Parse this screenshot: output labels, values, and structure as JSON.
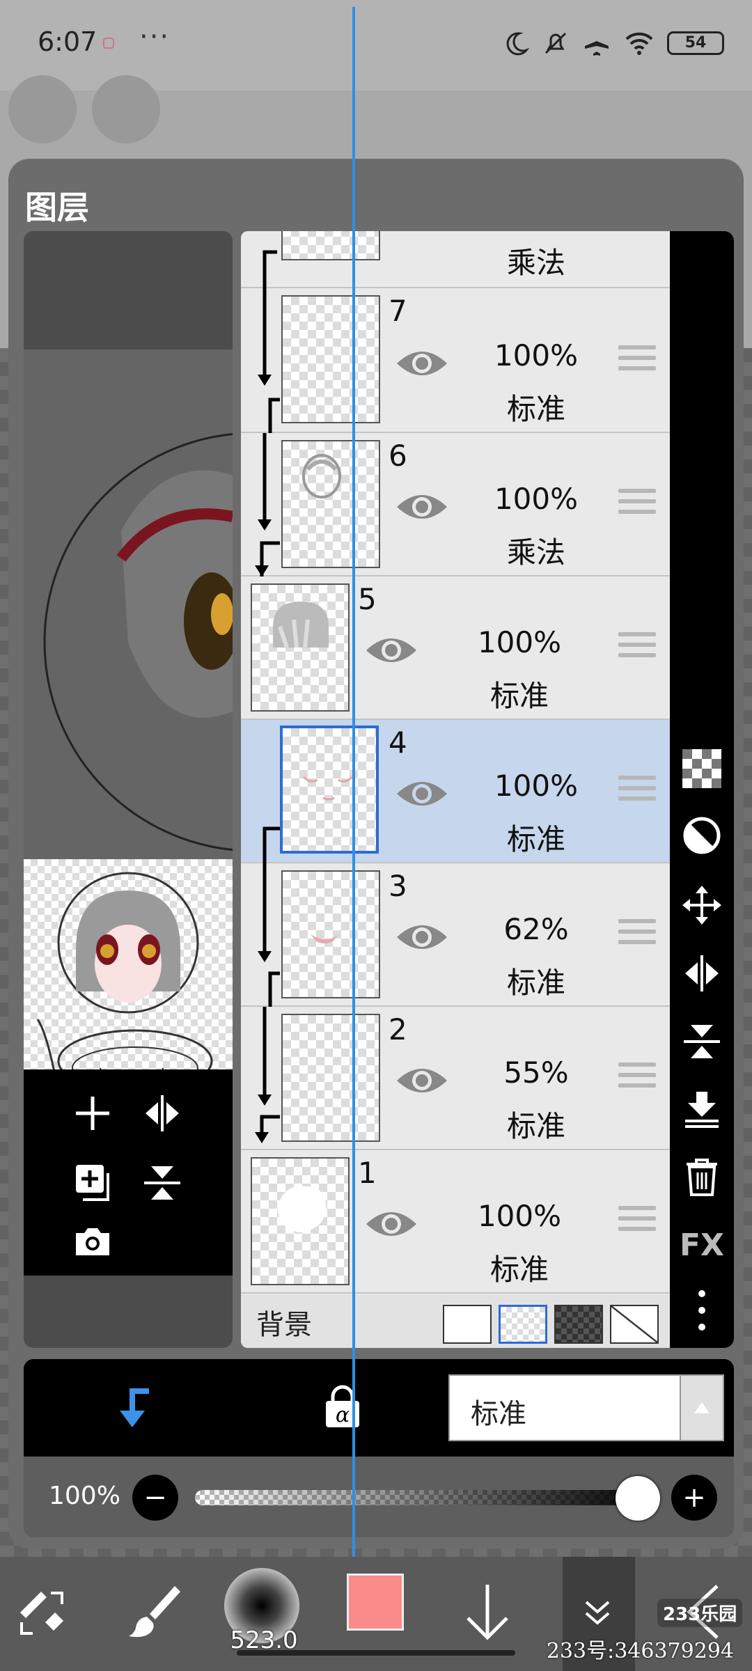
{
  "status_bar": {
    "time": "6:07",
    "more": "···",
    "battery": "54"
  },
  "panel": {
    "title": "图层"
  },
  "layers": [
    {
      "name": "partial",
      "number": "",
      "opacity": "",
      "blend": "乘法",
      "clipped": true,
      "selected": false
    },
    {
      "name": "7",
      "number": "7",
      "opacity": "100%",
      "blend": "标准",
      "clipped": true,
      "selected": false
    },
    {
      "name": "6",
      "number": "6",
      "opacity": "100%",
      "blend": "乘法",
      "clipped": true,
      "selected": false
    },
    {
      "name": "5",
      "number": "5",
      "opacity": "100%",
      "blend": "标准",
      "clipped": false,
      "selected": false
    },
    {
      "name": "4",
      "number": "4",
      "opacity": "100%",
      "blend": "标准",
      "clipped": true,
      "selected": true
    },
    {
      "name": "3",
      "number": "3",
      "opacity": "62%",
      "blend": "标准",
      "clipped": true,
      "selected": false
    },
    {
      "name": "2",
      "number": "2",
      "opacity": "55%",
      "blend": "标准",
      "clipped": true,
      "selected": false
    },
    {
      "name": "1",
      "number": "1",
      "opacity": "100%",
      "blend": "标准",
      "clipped": false,
      "selected": false
    }
  ],
  "background_row": {
    "label": "背景"
  },
  "right_tools": {
    "fx_label": "FX"
  },
  "controls": {
    "blend_mode": "标准",
    "opacity_label": "100%",
    "opacity_value": 1.0
  },
  "toolbar": {
    "brush_size": "523.0",
    "color": "#fb8a8a"
  },
  "watermark": {
    "logo": "233乐园",
    "text": "233号:346379294"
  },
  "colors": {
    "accent": "#2d6bd6",
    "selected_row": "#c6d6ec",
    "guide": "#2f8fe6"
  }
}
